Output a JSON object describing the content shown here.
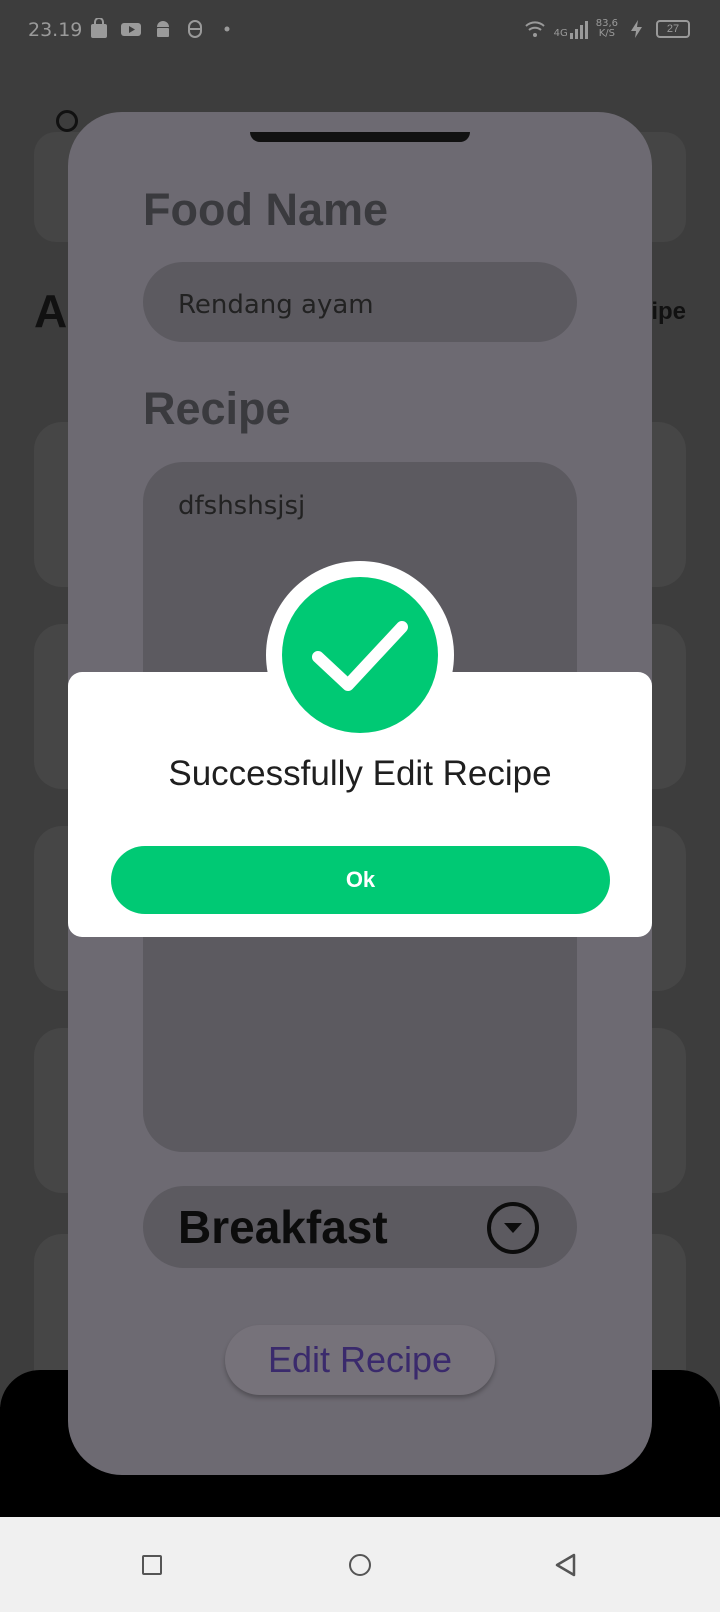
{
  "status_bar": {
    "time": "23.19",
    "network_speed_value": "83,6",
    "network_speed_unit": "K/S",
    "network_type": "4G",
    "battery": "27"
  },
  "background": {
    "heading_start": "A",
    "heading_right": "ipe"
  },
  "form": {
    "food_name_label": "Food Name",
    "food_name_value": "Rendang ayam",
    "recipe_label": "Recipe",
    "recipe_value": "dfshshsjsj",
    "category_value": "Breakfast",
    "submit_label": "Edit Recipe"
  },
  "dialog": {
    "message": "Successfully Edit Recipe",
    "ok_label": "Ok",
    "accent_color": "#00c974"
  },
  "nav": {
    "icons": [
      "recents-icon",
      "home-icon",
      "back-icon"
    ]
  }
}
